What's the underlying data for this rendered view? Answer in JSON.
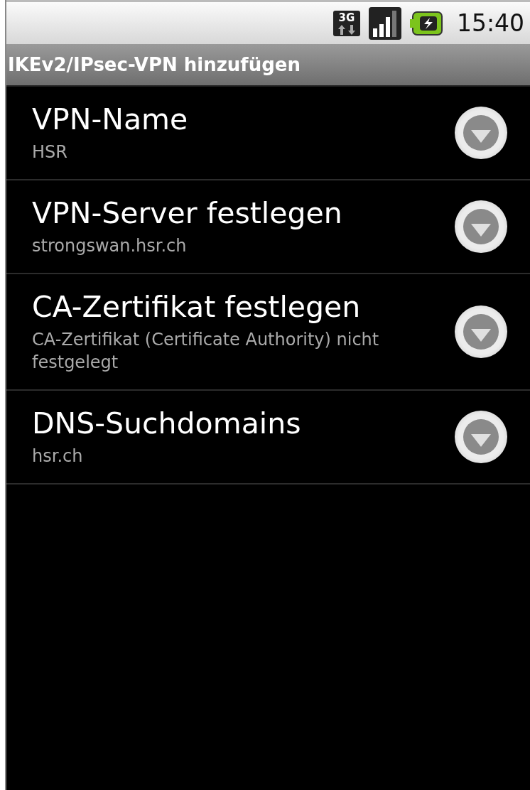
{
  "status_bar": {
    "time": "15:40",
    "network": "3G"
  },
  "title": "IKEv2/IPsec-VPN hinzufügen",
  "settings": [
    {
      "title": "VPN-Name",
      "summary": "HSR"
    },
    {
      "title": "VPN-Server festlegen",
      "summary": "strongswan.hsr.ch"
    },
    {
      "title": "CA-Zertifikat festlegen",
      "summary": "CA-Zertifikat (Certificate Authority) nicht festgelegt"
    },
    {
      "title": "DNS-Suchdomains",
      "summary": "hsr.ch"
    }
  ]
}
